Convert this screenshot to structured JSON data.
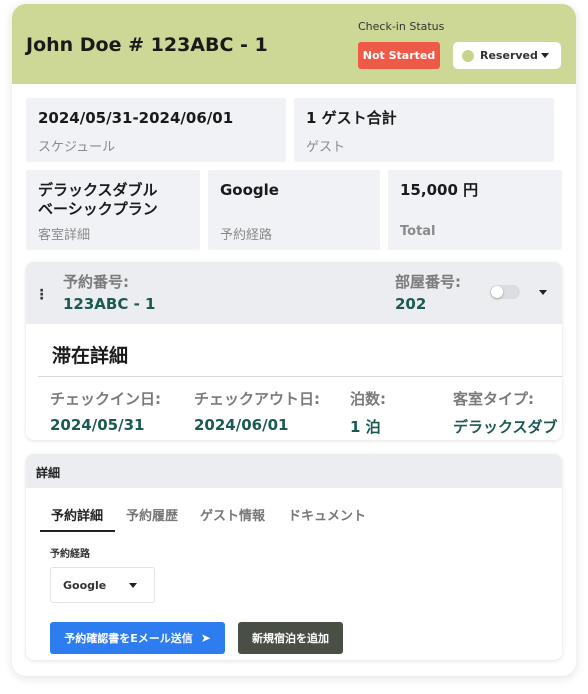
{
  "header": {
    "guest_title": "John Doe # 123ABC - 1",
    "checkin_status_label": "Check-in Status",
    "status_badge": "Not Started",
    "reservation_status": "Reserved",
    "colors": {
      "header_bg": "#cdd896",
      "status_badge_bg": "#ef5a48",
      "reserved_dot": "#c6d48c"
    }
  },
  "summary": {
    "schedule": {
      "value": "2024/05/31-2024/06/01",
      "label": "スケジュール"
    },
    "guests": {
      "value": "1 ゲスト合計",
      "label": "ゲスト"
    },
    "room": {
      "value_line1": "デラックスダブル",
      "value_line2": "ベーシックプラン",
      "label": "客室詳細"
    },
    "channel": {
      "value": "Google",
      "label": "予約経路"
    },
    "total": {
      "value": "15,000 円",
      "label": "Total"
    }
  },
  "reservation": {
    "number_label": "予約番号:",
    "number_value": "123ABC - 1",
    "room_label": "部屋番号:",
    "room_value": "202",
    "stay_title": "滞在詳細",
    "columns": [
      {
        "label": "チェックイン日:",
        "value": "2024/05/31"
      },
      {
        "label": "チェックアウト日:",
        "value": "2024/06/01"
      },
      {
        "label": "泊数:",
        "value": "1 泊"
      },
      {
        "label": "客室タイプ:",
        "value": "デラックスダブ"
      }
    ]
  },
  "details": {
    "title": "詳細",
    "tabs": [
      "予約詳細",
      "予約履歴",
      "ゲスト情報",
      "ドキュメント"
    ],
    "active_tab": "予約詳細",
    "source_label": "予約経路",
    "source_value": "Google",
    "email_button": "予約確認書をEメール送信",
    "add_stay_button": "新規宿泊を追加",
    "colors": {
      "email_button_bg": "#2d7df0",
      "add_button_bg": "#4a4f46"
    }
  }
}
